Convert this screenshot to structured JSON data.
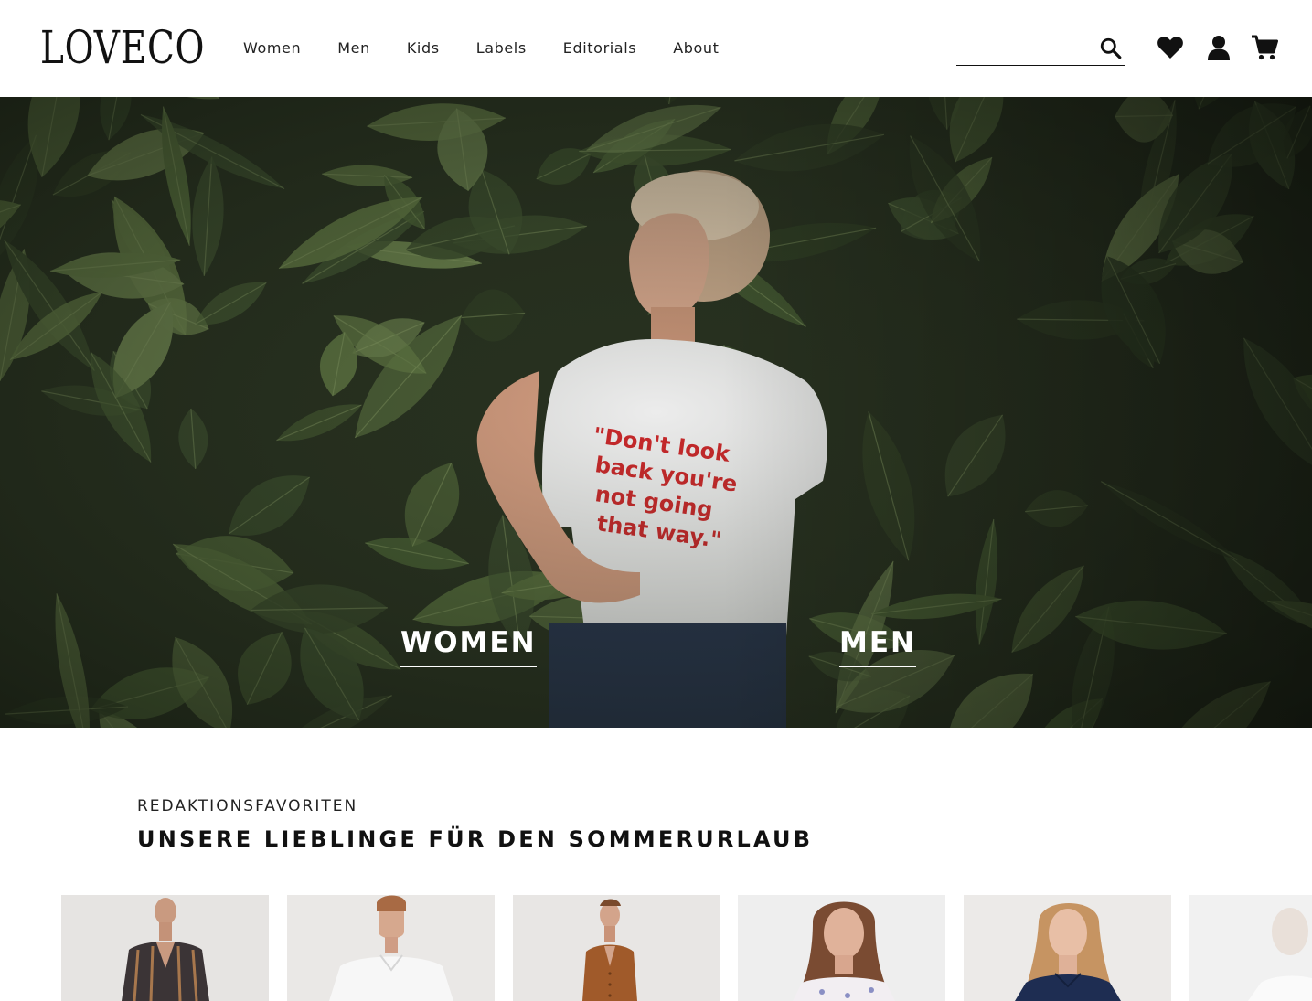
{
  "header": {
    "logo": "LOVECO",
    "nav": [
      "Women",
      "Men",
      "Kids",
      "Labels",
      "Editorials",
      "About"
    ],
    "search": {
      "value": "",
      "placeholder": ""
    },
    "icons": [
      "search-icon",
      "heart-icon",
      "user-icon",
      "cart-icon"
    ]
  },
  "hero": {
    "links": [
      "WOMEN",
      "MEN"
    ],
    "tshirt_text": "\"Don't look back you're not going that way.\""
  },
  "editorial": {
    "eyebrow": "REDAKTIONSFAVORITEN",
    "title": "UNSERE LIEBLINGE FÜR DEN SOMMERURLAUB"
  },
  "products": [
    {
      "name": "striped shirt"
    },
    {
      "name": "white blouse"
    },
    {
      "name": "brown cardigan"
    },
    {
      "name": "floral top"
    },
    {
      "name": "navy shirt"
    },
    {
      "name": "white top"
    }
  ],
  "colors": {
    "text": "#111111",
    "hero_overlay": "#1d2418",
    "leaf": "#556b3a",
    "tshirt_print": "#c8282a"
  }
}
